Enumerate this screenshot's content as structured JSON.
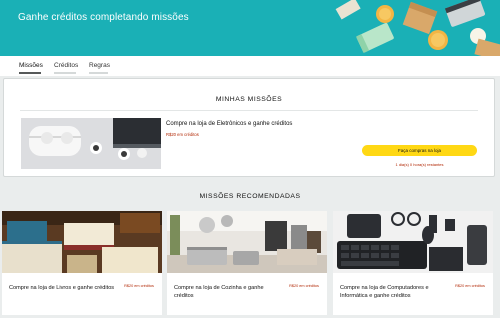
{
  "hero": {
    "title": "Ganhe créditos completando missões",
    "background": "#1ab0b6"
  },
  "tabs": [
    {
      "label": "Missões",
      "active": true
    },
    {
      "label": "Créditos",
      "active": false
    },
    {
      "label": "Regras",
      "active": false
    }
  ],
  "my_missions": {
    "title": "MINHAS MISSÕES",
    "mission": {
      "title": "Compre na loja de Eletrônicos e ganhe créditos",
      "reward": "R$20 em créditos",
      "button_label": "Faça compras na loja",
      "time_left": "1 dia(s) 0 hora(s) restantes",
      "image_icon": "wireless-earbuds-image"
    }
  },
  "recommended": {
    "title": "MISSÕES RECOMENDADAS",
    "items": [
      {
        "title": "Compre na loja de Livros e ganhe créditos",
        "reward": "R$20 em créditos",
        "image_icon": "books-image"
      },
      {
        "title": "Compre na loja de Cozinha e ganhe créditos",
        "reward": "R$20 em créditos",
        "image_icon": "kitchen-image"
      },
      {
        "title": "Compre na loja de Computadores e Informática e ganhe créditos",
        "reward": "R$20 em créditos",
        "image_icon": "computer-peripherals-image"
      }
    ]
  },
  "colors": {
    "accent_button": "#ffd814",
    "reward_text": "#b12704",
    "page_background": "#eaeded"
  }
}
